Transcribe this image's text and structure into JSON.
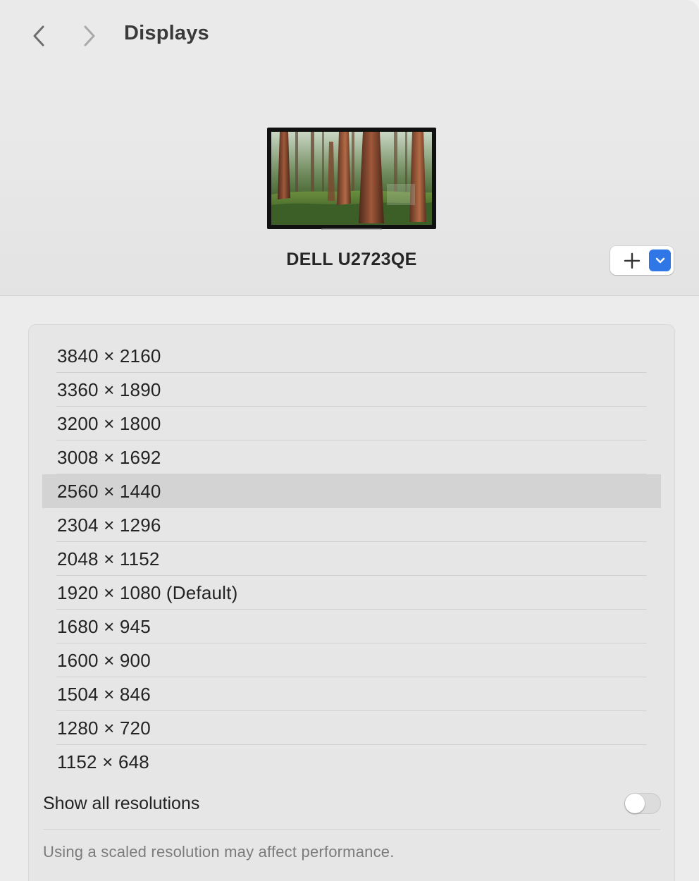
{
  "header": {
    "title": "Displays",
    "back_icon": "chevron-left-icon",
    "forward_icon": "chevron-right-icon"
  },
  "display": {
    "name": "DELL U2723QE",
    "wallpaper": "redwood-forest"
  },
  "add_control": {
    "add_icon": "plus-icon",
    "menu_icon": "chevron-down-icon",
    "menu_color": "#2f76e6"
  },
  "resolutions": {
    "items": [
      {
        "label": "3840 × 2160"
      },
      {
        "label": "3360 × 1890"
      },
      {
        "label": "3200 × 1800"
      },
      {
        "label": "3008 × 1692"
      },
      {
        "label": "2560 × 1440",
        "selected": true
      },
      {
        "label": "2304 × 1296"
      },
      {
        "label": "2048 × 1152"
      },
      {
        "label": "1920 × 1080 (Default)"
      },
      {
        "label": "1680 × 945"
      },
      {
        "label": "1600 × 900"
      },
      {
        "label": "1504 × 846"
      },
      {
        "label": "1280 × 720"
      },
      {
        "label": "1152 × 648"
      }
    ],
    "selected_label": "2560 × 1440"
  },
  "show_all": {
    "label": "Show all resolutions",
    "enabled": false
  },
  "footnote": "Using a scaled resolution may affect performance."
}
